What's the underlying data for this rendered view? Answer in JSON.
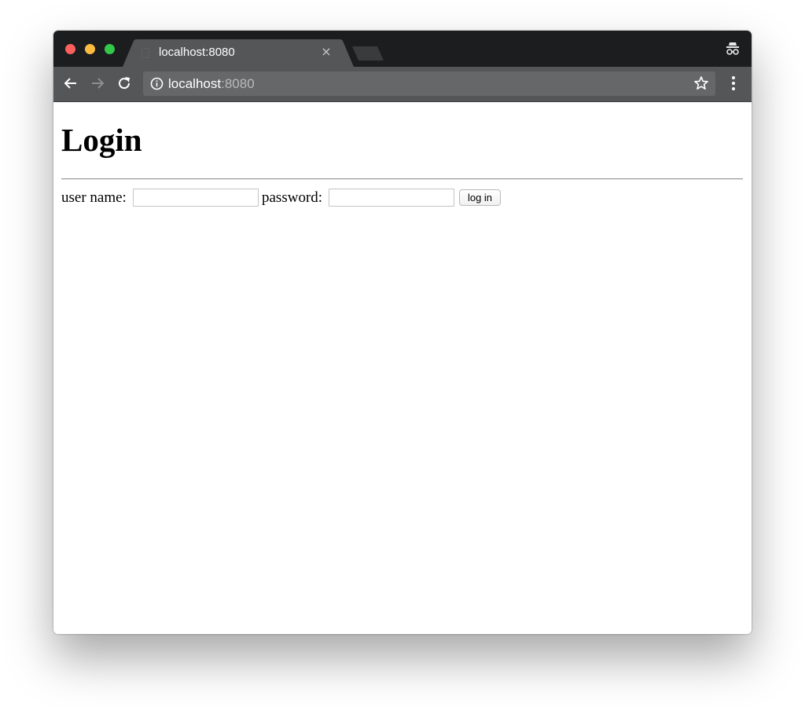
{
  "browser": {
    "tab": {
      "title": "localhost:8080",
      "close_glyph": "×"
    },
    "address_bar": {
      "host": "localhost",
      "port": ":8080"
    },
    "icons": {
      "back": "arrow-left-icon",
      "forward": "arrow-right-icon",
      "reload": "reload-icon",
      "info": "info-icon",
      "bookmark": "star-icon",
      "menu": "kebab-menu-icon",
      "incognito": "incognito-icon"
    },
    "colors": {
      "tabstrip": "#1c1d1f",
      "toolbar": "#555658",
      "omnibox": "#666769",
      "traffic_close": "#fc605c",
      "traffic_min": "#fdbc40",
      "traffic_max": "#34c84a"
    }
  },
  "page": {
    "heading": "Login",
    "form": {
      "username_label": "user name:",
      "username_value": "",
      "password_label": "password:",
      "password_value": "",
      "submit_label": "log in"
    }
  }
}
